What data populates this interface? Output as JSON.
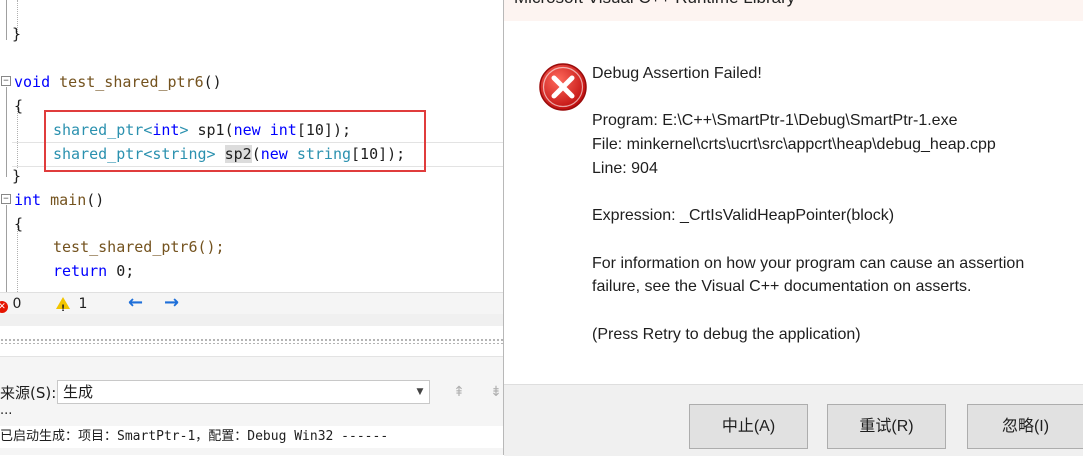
{
  "editor": {
    "closing_brace_top": "}",
    "func_kw": "void",
    "func_name": "test_shared_ptr6",
    "func_parens": "()",
    "open_brace": "{",
    "line1": {
      "type": "shared_ptr",
      "lt": "<",
      "arg": "int",
      "gt": ">",
      "var": " sp1(",
      "new_kw": "new",
      "sp": " ",
      "arr_type": "int",
      "rest": "[10]);"
    },
    "line2": {
      "type": "shared_ptr",
      "lt": "<",
      "arg": "string",
      "gt": ">",
      "sp0": " ",
      "var": "sp2",
      "paren": "(",
      "new_kw": "new",
      "sp": " ",
      "arr_type": "string",
      "rest": "[10]);"
    },
    "close_brace": "}",
    "main_kw": "int",
    "main_name": " main",
    "main_parens": "()",
    "main_open": "{",
    "call_line": "test_shared_ptr6();",
    "return_kw": "return",
    "return_rest": " 0;"
  },
  "status": {
    "errors": "0",
    "warnings": "1",
    "back_icon": "arrow-left-icon",
    "fwd_icon": "arrow-right-icon"
  },
  "output": {
    "source_label": "来源(S):",
    "source_value": "生成",
    "ellipsis": "...",
    "line1": "已启动生成：项目：SmartPtr-1，配置：Debug Win32 ------"
  },
  "dialog": {
    "title": "Microsoft Visual C++ Runtime Library",
    "heading": "Debug Assertion Failed!",
    "program": "Program: E:\\C++\\SmartPtr-1\\Debug\\SmartPtr-1.exe",
    "file": "File: minkernel\\crts\\ucrt\\src\\appcrt\\heap\\debug_heap.cpp",
    "line": "Line: 904",
    "expression": "Expression: _CrtIsValidHeapPointer(block)",
    "info1": "For information on how your program can cause an assertion",
    "info2": "failure, see the Visual C++ documentation on asserts.",
    "press": "(Press Retry to debug the application)",
    "buttons": {
      "abort": "中止(A)",
      "retry": "重试(R)",
      "ignore": "忽略(I)"
    },
    "icon": "error-icon",
    "icon_color": "#d81e1e"
  }
}
